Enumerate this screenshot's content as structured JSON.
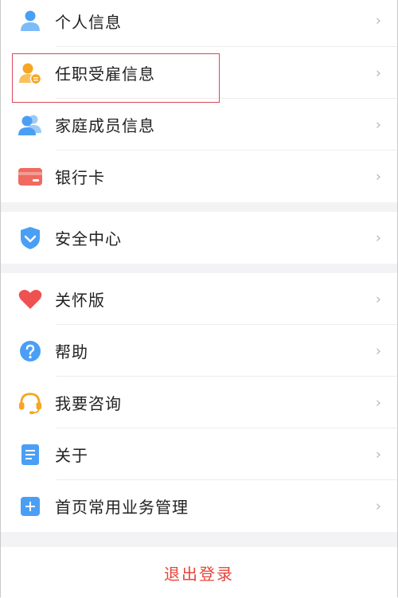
{
  "colors": {
    "accent_red": "#e8443a",
    "highlight": "#d64a5a",
    "blue": "#4a9ff5",
    "orange": "#f5a623"
  },
  "groups": [
    {
      "items": [
        {
          "label": "个人信息",
          "icon": "person-icon"
        },
        {
          "label": "任职受雇信息",
          "icon": "employee-icon"
        },
        {
          "label": "家庭成员信息",
          "icon": "family-icon"
        },
        {
          "label": "银行卡",
          "icon": "bank-card-icon"
        }
      ]
    },
    {
      "items": [
        {
          "label": "安全中心",
          "icon": "shield-icon"
        }
      ]
    },
    {
      "items": [
        {
          "label": "关怀版",
          "icon": "heart-icon"
        },
        {
          "label": "帮助",
          "icon": "help-icon"
        },
        {
          "label": "我要咨询",
          "icon": "headset-icon"
        },
        {
          "label": "关于",
          "icon": "document-icon"
        },
        {
          "label": "首页常用业务管理",
          "icon": "plus-grid-icon"
        }
      ]
    }
  ],
  "chevron": "›",
  "logout_label": "退出登录"
}
